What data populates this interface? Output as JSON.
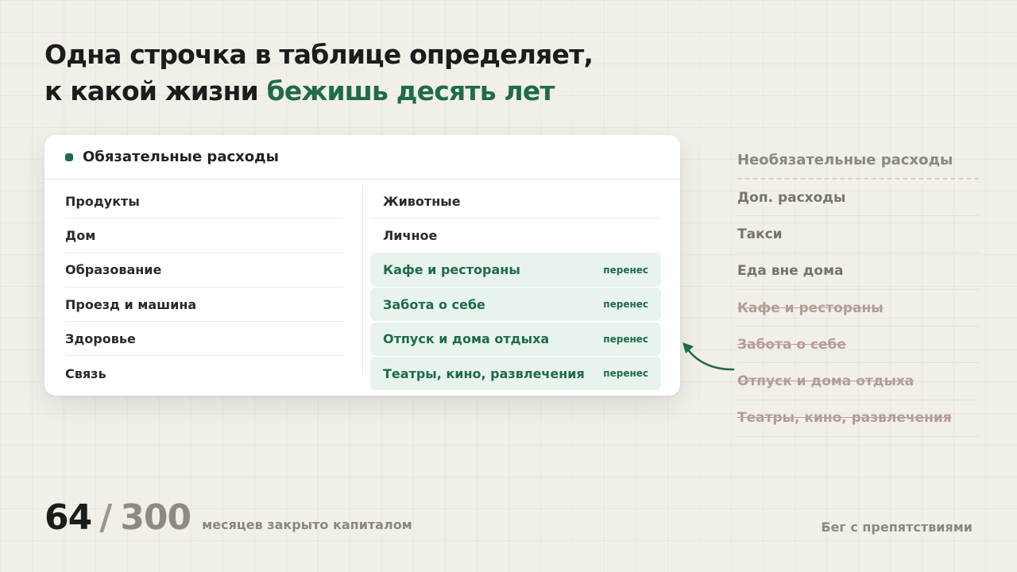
{
  "headline": {
    "line1": "Одна строчка в таблице определяет,",
    "line2_plain": "к какой жизни ",
    "line2_accent": "бежишь десять лет"
  },
  "card": {
    "title": "Обязательные расходы",
    "left_items": [
      "Продукты",
      "Дом",
      "Образование",
      "Проезд и машина",
      "Здоровье",
      "Связь"
    ],
    "right_items": [
      "Животные",
      "Личное"
    ],
    "moved_items": [
      {
        "label": "Кафе и рестораны",
        "tag": "перенес"
      },
      {
        "label": "Забота о себе",
        "tag": "перенес"
      },
      {
        "label": "Отпуск и дома отдыха",
        "tag": "перенес"
      },
      {
        "label": "Театры, кино, развлечения",
        "tag": "перенес"
      }
    ]
  },
  "side": {
    "title": "Необязательные расходы",
    "items": [
      "Доп. расходы",
      "Такси",
      "Еда вне дома"
    ],
    "struck_items": [
      "Кафе и рестораны",
      "Забота о себе",
      "Отпуск и дома отдыха",
      "Театры, кино, развлечения"
    ]
  },
  "footer": {
    "count": "64",
    "separator": "/",
    "total": "300",
    "caption": "месяцев закрыто капиталом",
    "brand": "Бег с препятствиями"
  },
  "colors": {
    "accent": "#1f6b4a",
    "moved_bg": "#e7f3ec",
    "struck_text": "#b39c94",
    "background": "#f2efe9"
  },
  "icons": {
    "header_marker": "square-dot-icon",
    "transfer_arrow": "curved-arrow-icon"
  }
}
